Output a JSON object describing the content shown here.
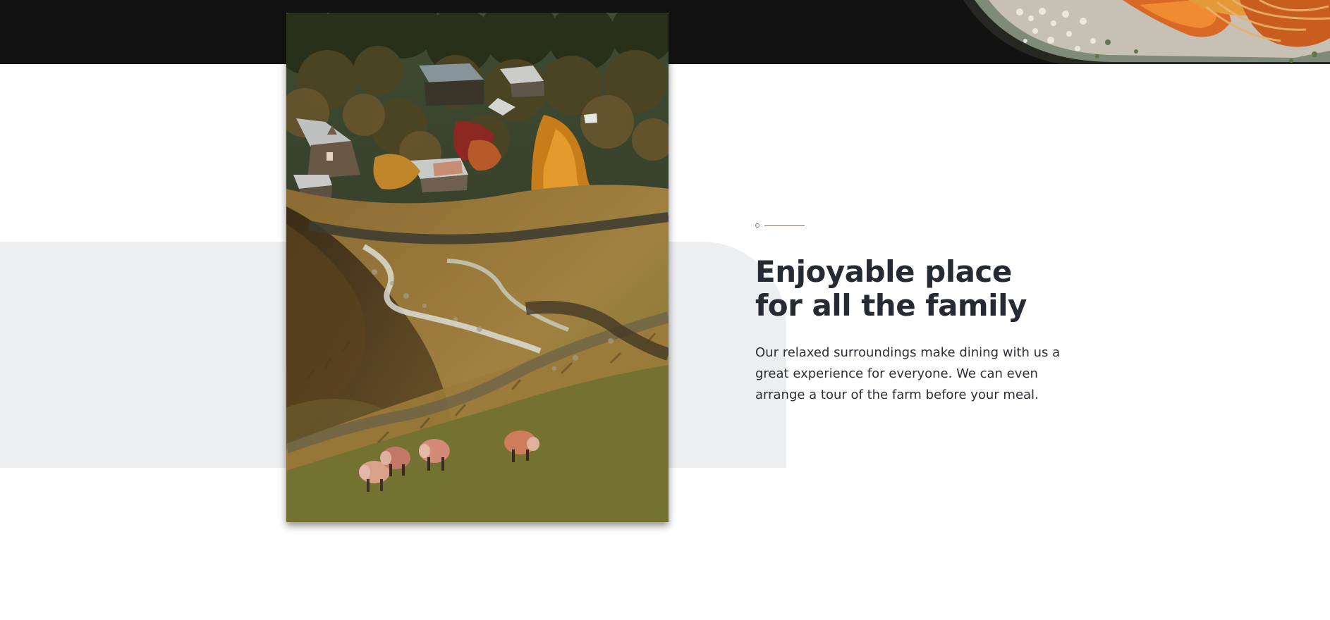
{
  "section": {
    "headline": "Enjoyable place for all the family",
    "description": "Our relaxed surroundings make dining with us a great experience for everyone. We can even arrange a tour of the farm before your meal."
  },
  "images": {
    "landscape": "countryside-valley-photo",
    "food": "seafood-pasta-photo"
  },
  "colors": {
    "dark_band": "#121212",
    "panel": "#eceef0",
    "headline": "#252a33",
    "accent": "#7d7466"
  }
}
